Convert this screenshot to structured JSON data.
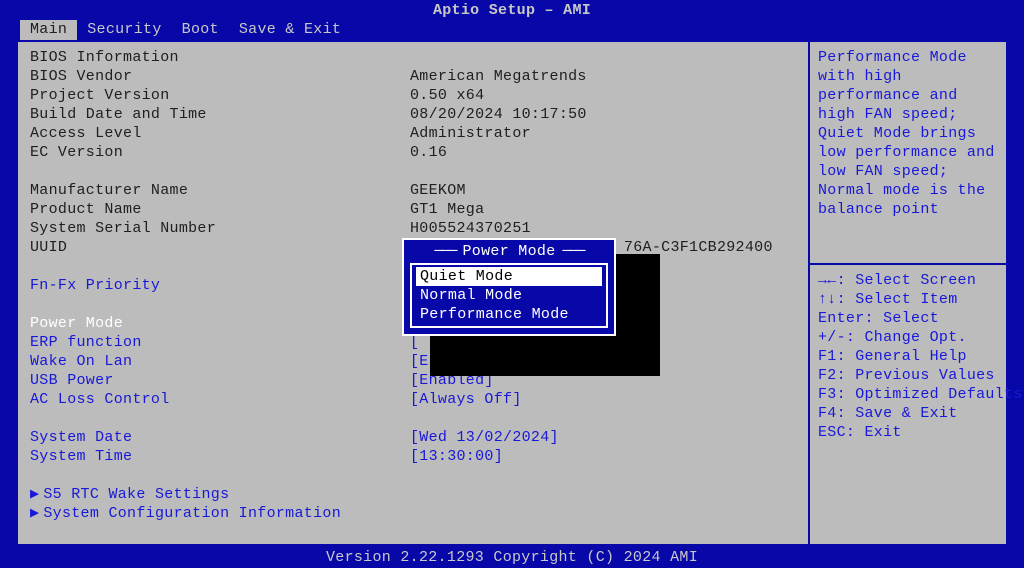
{
  "title": "Aptio Setup – AMI",
  "tabs": [
    "Main",
    "Security",
    "Boot",
    "Save & Exit"
  ],
  "active_tab_index": 0,
  "rows": [
    {
      "type": "header",
      "label": "BIOS Information"
    },
    {
      "type": "info",
      "label": "BIOS Vendor",
      "value": "American Megatrends"
    },
    {
      "type": "info",
      "label": "Project Version",
      "value": "0.50 x64"
    },
    {
      "type": "info",
      "label": "Build Date and Time",
      "value": "08/20/2024 10:17:50"
    },
    {
      "type": "info",
      "label": "Access Level",
      "value": "Administrator"
    },
    {
      "type": "info",
      "label": "EC Version",
      "value": "0.16"
    },
    {
      "type": "spacer"
    },
    {
      "type": "info",
      "label": "Manufacturer Name",
      "value": "GEEKOM"
    },
    {
      "type": "info",
      "label": "Product Name",
      "value": "GT1 Mega"
    },
    {
      "type": "info",
      "label": "System Serial Number",
      "value": "H005524370251"
    },
    {
      "type": "info",
      "label": "UUID",
      "value": "                       76A-C3F1CB292400"
    },
    {
      "type": "spacer"
    },
    {
      "type": "link",
      "label": "Fn-Fx Priority",
      "value": ""
    },
    {
      "type": "spacer"
    },
    {
      "type": "selected",
      "label": "Power Mode",
      "value": ""
    },
    {
      "type": "link",
      "label": "ERP function",
      "value": "["
    },
    {
      "type": "link",
      "label": "Wake On Lan",
      "value": "[Enabled]"
    },
    {
      "type": "link",
      "label": "USB Power",
      "value": "[Enabled]"
    },
    {
      "type": "link",
      "label": "AC Loss Control",
      "value": "[Always Off]"
    },
    {
      "type": "spacer"
    },
    {
      "type": "link",
      "label": "System Date",
      "value": "[Wed 13/02/2024]"
    },
    {
      "type": "link",
      "label": "System Time",
      "value": "[13:30:00]"
    },
    {
      "type": "spacer"
    },
    {
      "type": "submenu",
      "label": "S5 RTC Wake Settings"
    },
    {
      "type": "submenu",
      "label": "System Configuration Information"
    }
  ],
  "help_text": "Performance Mode with high performance and high FAN speed; Quiet Mode brings low performance and low FAN speed; Normal mode is the balance point",
  "help_keys": [
    "→←: Select Screen",
    "↑↓: Select Item",
    "Enter: Select",
    "+/-: Change Opt.",
    "F1: General Help",
    "F2: Previous Values",
    "F3: Optimized Defaults",
    "F4: Save & Exit",
    "ESC: Exit"
  ],
  "popup": {
    "title": "Power Mode",
    "options": [
      "Quiet Mode",
      "Normal Mode",
      "Performance Mode"
    ],
    "selected_index": 0
  },
  "footer": "Version 2.22.1293 Copyright (C) 2024 AMI"
}
